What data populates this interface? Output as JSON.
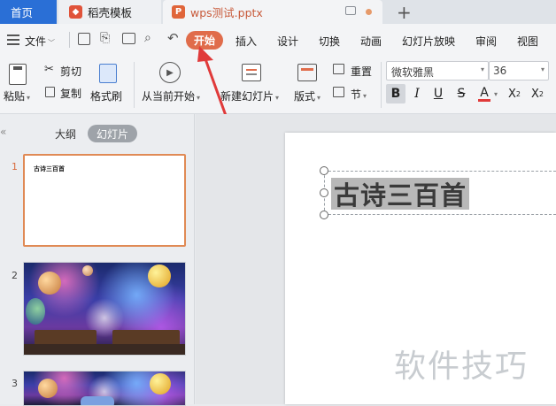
{
  "tabs": {
    "home": "首页",
    "daoke": "稻壳模板",
    "doc": "wps测试.pptx"
  },
  "menu": {
    "file": "文件",
    "items": [
      "开始",
      "插入",
      "设计",
      "切换",
      "动画",
      "幻灯片放映",
      "审阅",
      "视图"
    ]
  },
  "toolbar": {
    "paste": "粘贴",
    "cut": "剪切",
    "copy": "复制",
    "format_painter": "格式刷",
    "from_current": "从当前开始",
    "new_slide": "新建幻灯片",
    "layout": "版式",
    "reset": "重置",
    "section": "节",
    "font_name": "微软雅黑",
    "font_size": "36"
  },
  "panel": {
    "outline_tab": "大纲",
    "slides_tab": "幻灯片",
    "slide_numbers": [
      "1",
      "2",
      "3"
    ],
    "thumb1_title": "古诗三百首"
  },
  "slide": {
    "title": "古诗三百首"
  },
  "watermark": "软件技巧",
  "colors": {
    "accent_orange": "#e06c4b",
    "home_tab_blue": "#2a6fd6",
    "arrow_red": "#e03a3a"
  }
}
